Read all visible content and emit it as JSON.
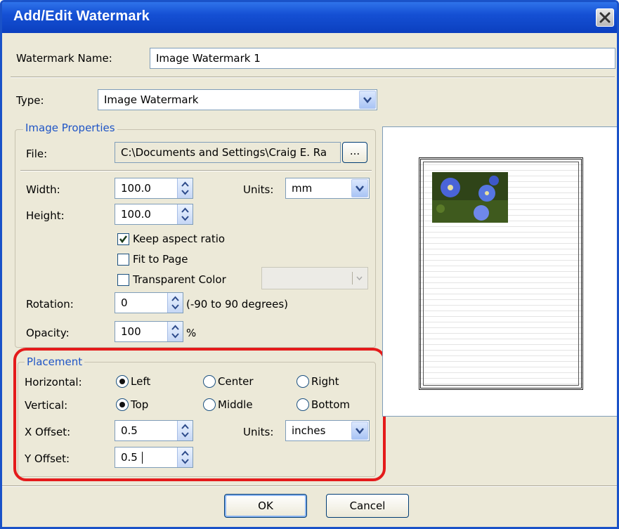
{
  "window": {
    "title": "Add/Edit Watermark"
  },
  "name_row": {
    "label": "Watermark Name:",
    "value": "Image Watermark 1"
  },
  "type_row": {
    "label": "Type:",
    "value": "Image Watermark"
  },
  "image_properties": {
    "legend": "Image Properties",
    "file_label": "File:",
    "file_value": "C:\\Documents and Settings\\Craig E. Ra",
    "browse_label": "...",
    "width_label": "Width:",
    "width_value": "100.0",
    "height_label": "Height:",
    "height_value": "100.0",
    "units_label": "Units:",
    "units_value": "mm",
    "keep_aspect_label": "Keep aspect ratio",
    "keep_aspect_checked": true,
    "fit_to_page_label": "Fit to Page",
    "fit_to_page_checked": false,
    "transparent_label": "Transparent Color",
    "transparent_checked": false,
    "rotation_label": "Rotation:",
    "rotation_value": "0",
    "rotation_hint": "(-90 to 90 degrees)",
    "opacity_label": "Opacity:",
    "opacity_value": "100",
    "opacity_unit": "%"
  },
  "placement": {
    "legend": "Placement",
    "horizontal_label": "Horizontal:",
    "horizontal_options": [
      "Left",
      "Center",
      "Right"
    ],
    "horizontal_selected": "Left",
    "vertical_label": "Vertical:",
    "vertical_options": [
      "Top",
      "Middle",
      "Bottom"
    ],
    "vertical_selected": "Top",
    "x_offset_label": "X Offset:",
    "x_offset_value": "0.5",
    "y_offset_label": "Y Offset:",
    "y_offset_value": "0.5",
    "units_label": "Units:",
    "units_value": "inches"
  },
  "buttons": {
    "ok": "OK",
    "cancel": "Cancel"
  },
  "colors": {
    "titlebar": "#1550d4",
    "dialog_bg": "#ece9d8",
    "group_legend": "#1f55c6",
    "highlight": "#e41b1b"
  }
}
